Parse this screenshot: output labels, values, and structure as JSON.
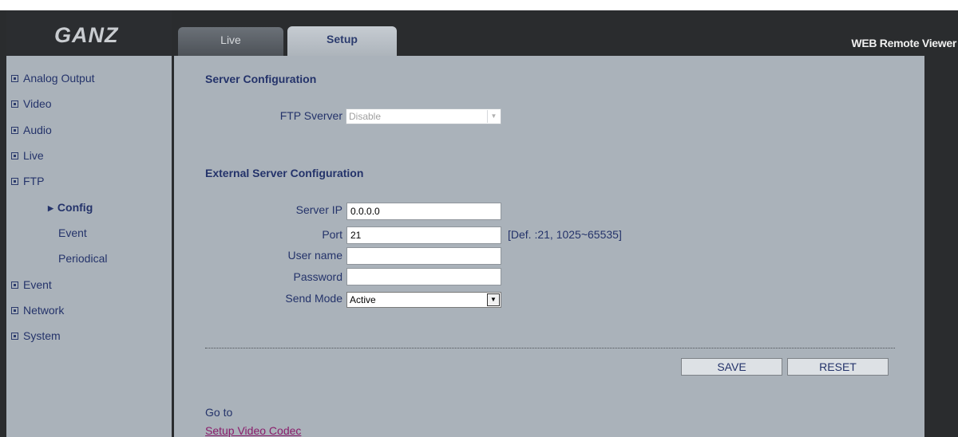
{
  "header": {
    "logo_text": "GANZ",
    "title": "WEB Remote Viewer",
    "tabs": [
      {
        "label": "Live",
        "active": false
      },
      {
        "label": "Setup",
        "active": true
      }
    ]
  },
  "sidebar": {
    "items": [
      {
        "label": "Analog Output"
      },
      {
        "label": "Video"
      },
      {
        "label": "Audio"
      },
      {
        "label": "Live"
      },
      {
        "label": "FTP"
      },
      {
        "label": "Event"
      },
      {
        "label": "Network"
      },
      {
        "label": "System"
      }
    ],
    "ftp_subitems": [
      {
        "label": "Config",
        "active": true
      },
      {
        "label": "Event",
        "active": false
      },
      {
        "label": "Periodical",
        "active": false
      }
    ]
  },
  "server_config": {
    "title": "Server Configuration",
    "ftp_server_label": "FTP Sverver",
    "ftp_server_value": "Disable"
  },
  "external_config": {
    "title": "External Server Configuration",
    "server_ip_label": "Server IP",
    "server_ip_value": "0.0.0.0",
    "port_label": "Port",
    "port_value": "21",
    "port_hint": "[Def. :21, 1025~65535]",
    "username_label": "User name",
    "username_value": "",
    "password_label": "Password",
    "password_value": "",
    "send_mode_label": "Send Mode",
    "send_mode_value": "Active"
  },
  "actions": {
    "save_label": "SAVE",
    "reset_label": "RESET"
  },
  "footer": {
    "goto_label": "Go to",
    "link_label": "Setup Video Codec"
  },
  "colors": {
    "panel_bg": "#aab2ba",
    "frame_bg": "#2a2c2e",
    "text_primary": "#24336a",
    "link": "#8a1c6b"
  }
}
